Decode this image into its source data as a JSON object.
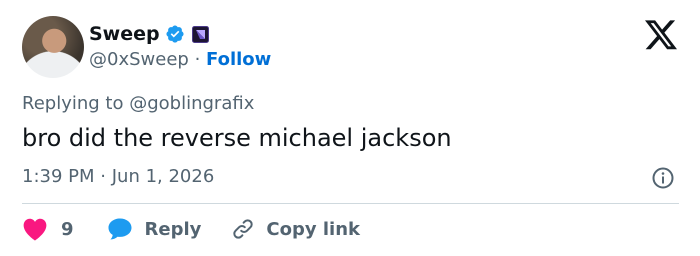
{
  "tweet": {
    "author": {
      "name": "Sweep",
      "handle": "@0xSweep",
      "separator": "·",
      "follow_label": "Follow"
    },
    "reply_context": {
      "prefix": "Replying to",
      "mention": "@goblingrafix"
    },
    "text": "bro did the reverse michael jackson",
    "timestamp": {
      "time": "1:39 PM",
      "separator": "·",
      "date": "Jun 1, 2026"
    },
    "actions": {
      "like_count": "9",
      "reply_label": "Reply",
      "copy_link_label": "Copy link"
    }
  },
  "icons": {
    "verified": "verified-badge-icon",
    "affiliate": "affiliate-badge-icon",
    "brand": "x-logo-icon",
    "info": "info-icon",
    "like": "heart-icon",
    "reply": "speech-bubble-icon",
    "copy": "link-icon"
  },
  "colors": {
    "verified_blue": "#1d9bf0",
    "follow_blue": "#006fd6",
    "like_red": "#f91880",
    "reply_blue": "#1d9bf0",
    "text_primary": "#0f1419",
    "text_secondary": "#536471",
    "divider": "#cfd9de"
  }
}
